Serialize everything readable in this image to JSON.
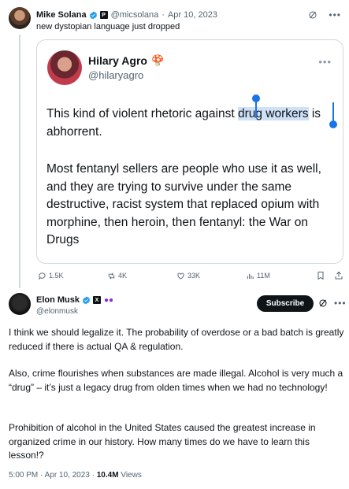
{
  "parent_tweet": {
    "name": "Mike Solana",
    "handle": "@micsolana",
    "date": "Apr 10, 2023",
    "text": "new dystopian language just dropped"
  },
  "quote": {
    "name": "Hilary Agro",
    "handle": "@hilaryagro",
    "emoji": "🍄",
    "p1_before": "This kind of violent rhetoric against ",
    "p1_highlight": "drug workers",
    "p1_after": " is abhorrent.",
    "p2": "Most fentanyl sellers are people who use it as well, and they are trying to survive under the same destructive, racist system that replaced opium with morphine, then heroin, then fentanyl: the War on Drugs"
  },
  "actions": {
    "replies": "1.5K",
    "reposts": "4K",
    "likes": "33K",
    "views": "11M"
  },
  "main_tweet": {
    "name": "Elon Musk",
    "handle": "@elonmusk",
    "subscribe_label": "Subscribe",
    "p1": "I think we should legalize it. The probability of overdose or a bad batch is greatly reduced if there is actual QA & regulation.",
    "p2": "Also, crime flourishes when substances are made illegal. Alcohol is very much a “drug” – it’s just a legacy drug from olden times when we had no technology!",
    "p3": "Prohibition of alcohol in the United States caused the greatest increase in organized crime in our history. How many times do we have to learn this lesson!?",
    "time": "5:00 PM",
    "date": "Apr 10, 2023",
    "views_count": "10.4M",
    "views_label": "Views"
  },
  "colors": {
    "verified": "#1d9bf0",
    "selection": "#1a73e8",
    "highlight": "#cfe1f7"
  }
}
